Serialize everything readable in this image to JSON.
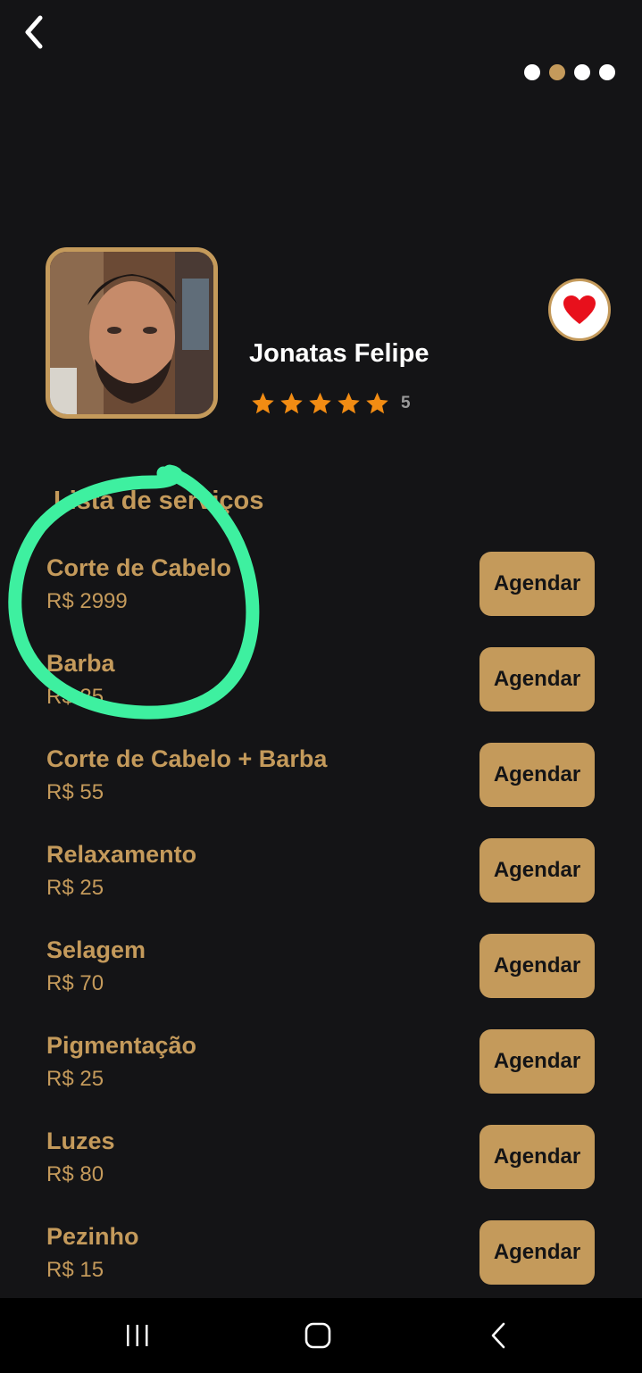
{
  "header": {
    "back_icon": "chevron-left-icon",
    "page_dots_count": 4,
    "page_dots_active_index": 1
  },
  "profile": {
    "name": "Jonatas Felipe",
    "rating": "5",
    "stars_filled": 5,
    "favorite_icon": "heart-icon"
  },
  "services": {
    "title": "Lista de serviços",
    "button_label": "Agendar",
    "items": [
      {
        "name": "Corte de Cabelo",
        "price": "R$ 2999"
      },
      {
        "name": "Barba",
        "price": "R$ 25"
      },
      {
        "name": "Corte de Cabelo + Barba",
        "price": "R$ 55"
      },
      {
        "name": "Relaxamento",
        "price": "R$ 25"
      },
      {
        "name": "Selagem",
        "price": "R$ 70"
      },
      {
        "name": "Pigmentação",
        "price": "R$ 25"
      },
      {
        "name": "Luzes",
        "price": "R$ 80"
      },
      {
        "name": "Pezinho",
        "price": "R$ 15"
      }
    ]
  },
  "nav_bar": {
    "recents_icon": "recent-apps-icon",
    "home_icon": "home-icon",
    "back_icon": "back-icon"
  },
  "colors": {
    "background": "#141416",
    "accent": "#c49a5b",
    "star": "#f28c13",
    "heart": "#e8101c",
    "annotation": "#3ef0a0"
  }
}
